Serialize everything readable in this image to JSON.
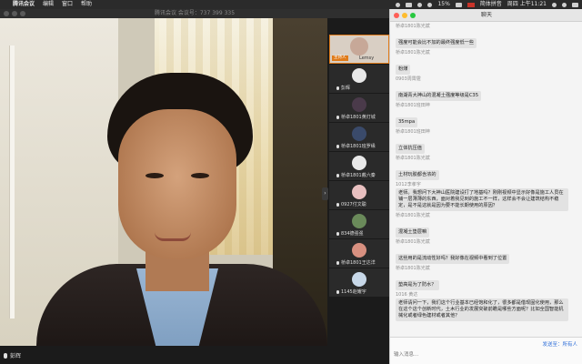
{
  "menubar": {
    "app": "腾讯会议",
    "items": [
      "编辑",
      "窗口",
      "帮助"
    ],
    "battery": "15%",
    "input_method": "简体拼音",
    "clock": "周四 上午11:21"
  },
  "meeting": {
    "title": "腾讯会议  会议号：737 399 335",
    "speaker_name": "彭辉"
  },
  "participants": [
    {
      "name": "Lemsy",
      "tag": "主持人",
      "avatar": "#c7a898",
      "active": true
    },
    {
      "name": "彭辉",
      "avatar": "#e8e8e8"
    },
    {
      "name": "桥卓1801黄灯城",
      "avatar": "#4a3a4a"
    },
    {
      "name": "桥卓1801班罗缘",
      "avatar": "#3a4a6a"
    },
    {
      "name": "桥卓1801戴六秦",
      "avatar": "#e8e8e8"
    },
    {
      "name": "0927付文聪",
      "avatar": "#e8c0c0"
    },
    {
      "name": "834德强强",
      "avatar": "#6a8a5a"
    },
    {
      "name": "桥卓1801王达洋",
      "avatar": "#d89080"
    },
    {
      "name": "1145赵耀宇",
      "avatar": "#c8d8e8"
    }
  ],
  "chat": {
    "title": "聊天",
    "send_to_label": "发送至：",
    "send_to": "所有人",
    "to_all_link": "允许所有人可看",
    "placeholder": "输入消息...",
    "messages": [
      {
        "sender": "桥卓1801陈光斌",
        "text": "强度可能会比不加的最终强度低一些"
      },
      {
        "sender": "桥卓1801陈光斌",
        "text": "粉煤"
      },
      {
        "sender": "0903周霄霆",
        "text": "南湖青大神山的混凝土强度等级是C35"
      },
      {
        "sender": "桥卓1801班田坤",
        "text": "35mpa"
      },
      {
        "sender": "桥卓1801班田坤",
        "text": "立体抗压值"
      },
      {
        "sender": "桥卓1801陈光斌",
        "text": "土材玩胶都含浓的"
      },
      {
        "sender": "1012李孝宇",
        "text": "老师。我想问下大神山医院建设打了地基吗？刚刚视频中显示好像是施工人员在铺一层薄薄的东西，面对着我见到的施工不一样，这样会不会让建筑结构不稳定，是不是这就是因为要不能长期使用的原因？"
      },
      {
        "sender": "桥卓1801陈光斌",
        "text": "混凝土垫层嘛"
      },
      {
        "sender": "桥卓1801陈光斌",
        "text": "这些用的是流动性好吗？我好像在视频中看到了位置"
      },
      {
        "sender": "桥卓1801陈光斌",
        "text": "垫高是为了防水？"
      },
      {
        "sender": "1016 黄达",
        "text": "老师请问一下，我们这个行业基本已经饱和化了，很多都是借现固化使用，那么在这个这个创新时代，土木行业的发展突破前瞻是哪些方面呢？比如全国智能机械化或者绿色建材或者其他？"
      }
    ]
  }
}
